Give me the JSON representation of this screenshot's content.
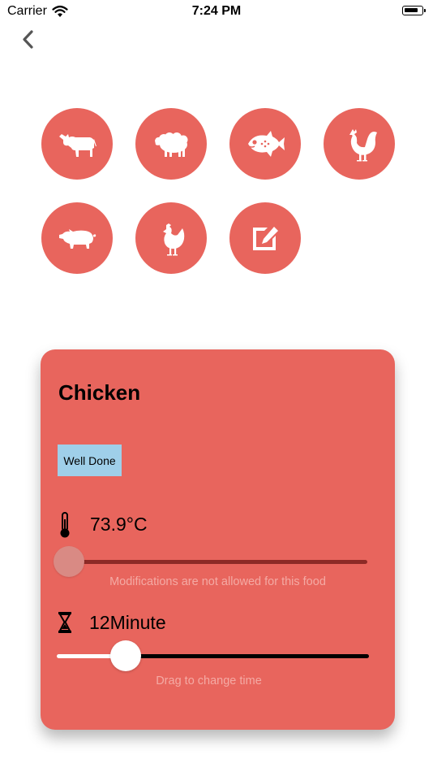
{
  "status_bar": {
    "carrier": "Carrier",
    "time": "7:24 PM"
  },
  "nav": {
    "back_icon": "chevron-left-icon"
  },
  "food_buttons": [
    {
      "name": "cow",
      "icon": "cow-icon"
    },
    {
      "name": "sheep",
      "icon": "sheep-icon"
    },
    {
      "name": "fish",
      "icon": "fish-icon"
    },
    {
      "name": "rooster",
      "icon": "rooster-icon"
    },
    {
      "name": "pig",
      "icon": "pig-icon"
    },
    {
      "name": "chicken",
      "icon": "chicken-icon"
    },
    {
      "name": "custom",
      "icon": "edit-icon"
    }
  ],
  "card": {
    "title": "Chicken",
    "doneness": "Well Done",
    "temperature": {
      "icon": "thermometer-icon",
      "value": "73.9°C",
      "slider_fraction": 0.0,
      "hint": "Modifications are not allowed for this food"
    },
    "time": {
      "icon": "hourglass-icon",
      "value": "12Minute",
      "slider_fraction": 0.22,
      "hint": "Drag to change time"
    }
  },
  "colors": {
    "accent": "#e8655d",
    "badge": "#9fcfe9",
    "temp_track": "#8d2a26",
    "hint_text": "#f4aaa4",
    "thumb_disabled": "#d98a84"
  }
}
